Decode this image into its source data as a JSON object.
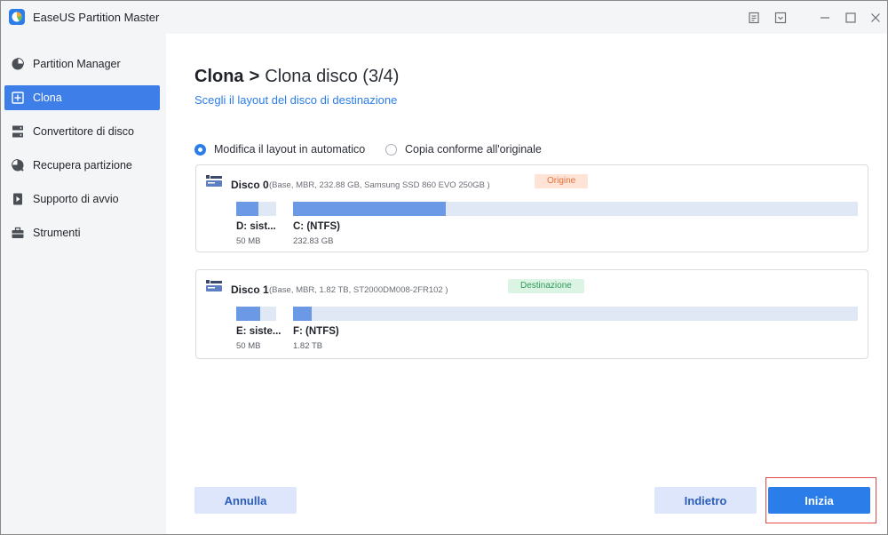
{
  "window": {
    "title": "EaseUS Partition Master"
  },
  "sidebar": {
    "items": [
      {
        "label": "Partition Manager",
        "icon": "pie-chart-icon",
        "active": false
      },
      {
        "label": "Clona",
        "icon": "clone-icon",
        "active": true
      },
      {
        "label": "Convertitore di disco",
        "icon": "disk-convert-icon",
        "active": false
      },
      {
        "label": "Recupera partizione",
        "icon": "recover-icon",
        "active": false
      },
      {
        "label": "Supporto di avvio",
        "icon": "bootable-media-icon",
        "active": false
      },
      {
        "label": "Strumenti",
        "icon": "toolbox-icon",
        "active": false
      }
    ]
  },
  "header": {
    "crumb_main": "Clona",
    "crumb_sep": ">",
    "crumb_step": "Clona disco (3/4)",
    "subtitle": "Scegli il layout del disco di destinazione"
  },
  "options": {
    "auto_label": "Modifica il layout in automatico",
    "auto_selected": true,
    "exact_label": "Copia conforme all'originale",
    "exact_selected": false
  },
  "disks": [
    {
      "name": "Disco 0",
      "info": "(Base, MBR, 232.88 GB, Samsung SSD 860 EVO 250GB )",
      "badge": "Origine",
      "partitions": [
        {
          "name": "D: sist...",
          "size": "50 MB",
          "used_fraction": 0.55
        },
        {
          "name": "C: (NTFS)",
          "size": "232.83 GB",
          "used_fraction": 0.27
        }
      ]
    },
    {
      "name": "Disco 1",
      "info": "(Base, MBR, 1.82 TB, ST2000DM008-2FR102 )",
      "badge": "Destinazione",
      "partitions": [
        {
          "name": "E: siste...",
          "size": "50 MB",
          "used_fraction": 0.6
        },
        {
          "name": "F: (NTFS)",
          "size": "1.82 TB",
          "used_fraction": 0.03
        }
      ]
    }
  ],
  "footer": {
    "cancel_label": "Annulla",
    "back_label": "Indietro",
    "start_label": "Inizia"
  },
  "colors": {
    "accent": "#2b7de9",
    "sidebar_active": "#3d7ee8",
    "bar_fill": "#6c99e6",
    "bar_track": "#e1e8f5",
    "badge_source": "#e8703a",
    "badge_destination": "#2e9a58",
    "highlight_border": "#e24a4a"
  }
}
